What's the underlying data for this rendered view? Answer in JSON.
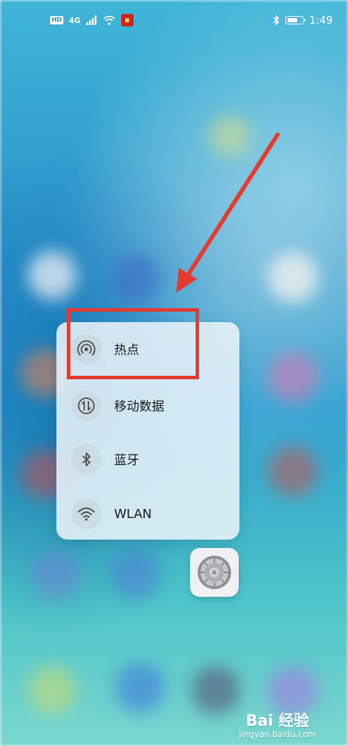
{
  "status_bar": {
    "hd_badge": "HD",
    "network": "4G",
    "time": "1:49",
    "battery_percent": 70
  },
  "menu": {
    "items": [
      {
        "label": "热点",
        "icon": "hotspot-icon"
      },
      {
        "label": "移动数据",
        "icon": "mobile-data-icon"
      },
      {
        "label": "蓝牙",
        "icon": "bluetooth-icon"
      },
      {
        "label": "WLAN",
        "icon": "wifi-icon"
      }
    ]
  },
  "settings_app": {
    "icon": "settings-gear-icon"
  },
  "annotation": {
    "highlight_color": "#e53a2f",
    "arrow_color": "#e53a2f"
  },
  "watermark": {
    "brand": "Bai 经验",
    "url": "jingyan.baidu.com"
  }
}
